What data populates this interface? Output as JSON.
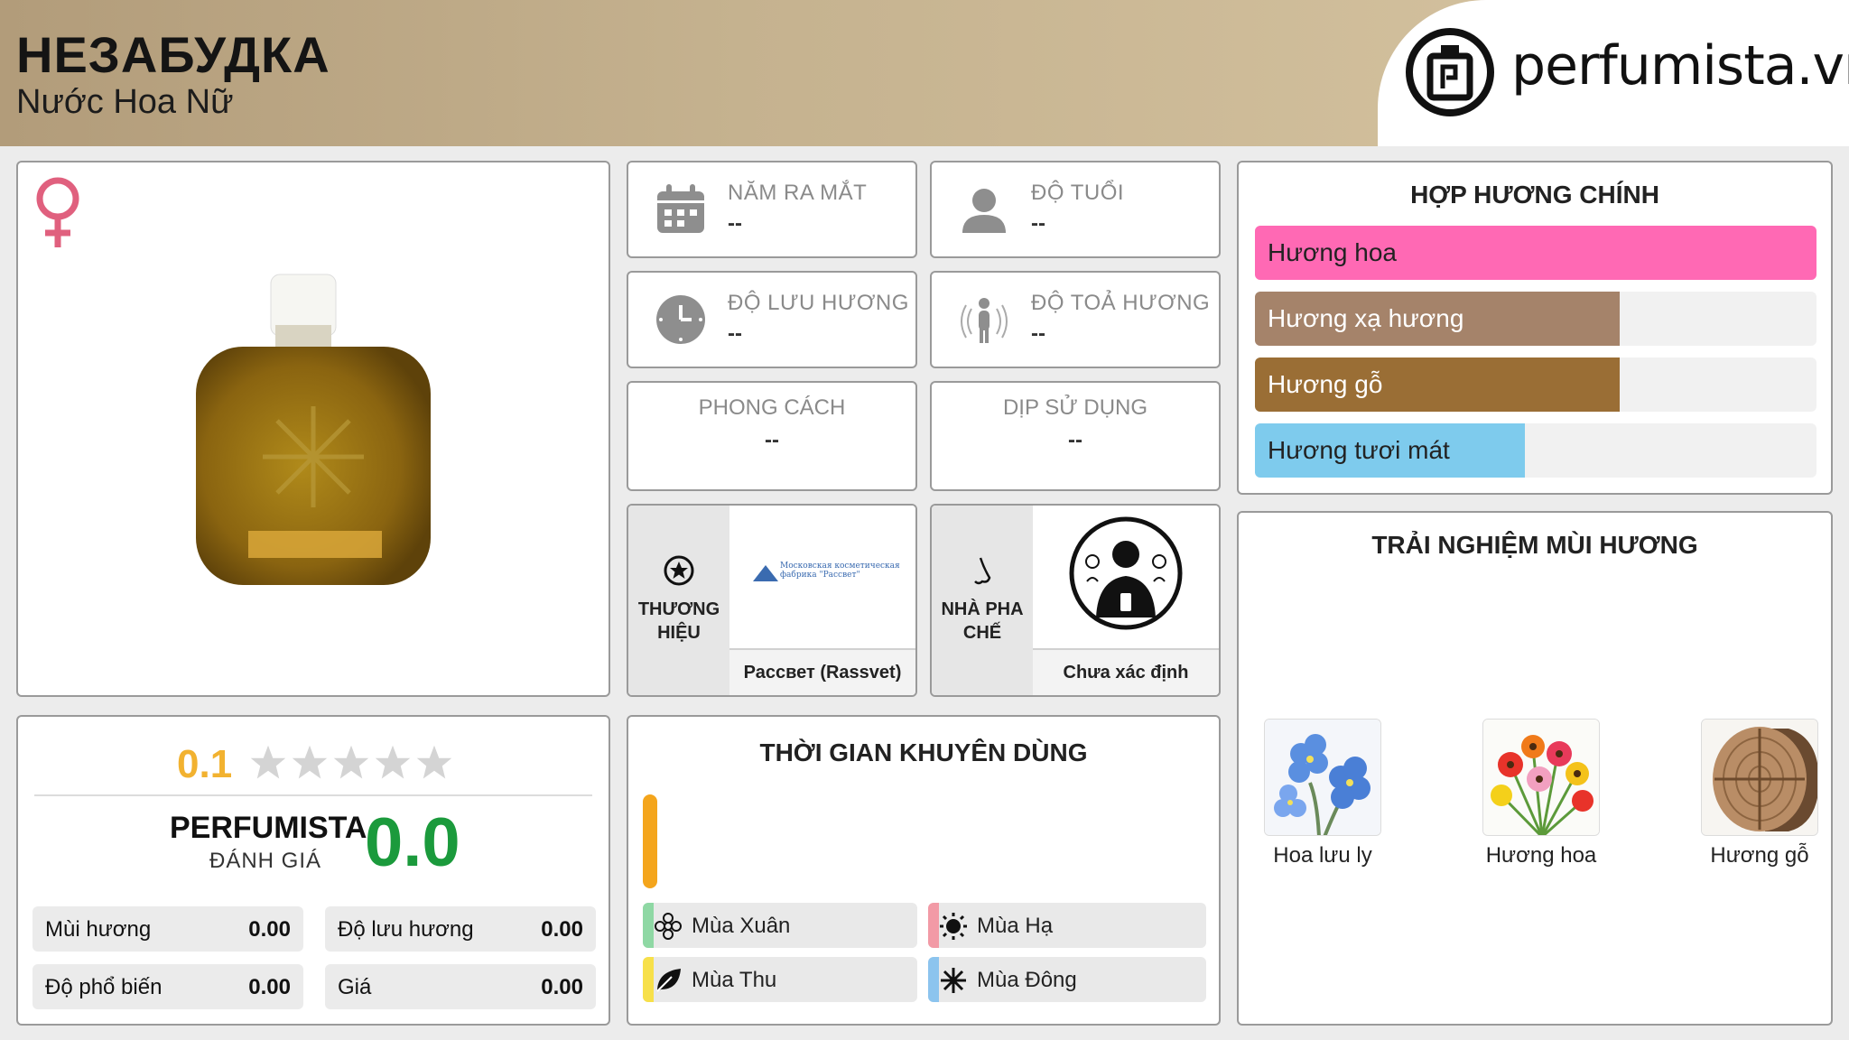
{
  "header": {
    "title": "НЕЗАБУДКА",
    "subtitle": "Nước Hoa Nữ",
    "logo_text": "perfumista.vn"
  },
  "info": {
    "release_label": "NĂM RA MẮT",
    "release_value": "--",
    "age_label": "ĐỘ TUỔI",
    "age_value": "--",
    "longevity_label": "ĐỘ LƯU HƯƠNG",
    "longevity_value": "--",
    "sillage_label": "ĐỘ TOẢ HƯƠNG",
    "sillage_value": "--",
    "style_label": "PHONG CÁCH",
    "style_value": "--",
    "occasion_label": "DỊP SỬ DỤNG",
    "occasion_value": "--"
  },
  "brand": {
    "label_line1": "THƯƠNG",
    "label_line2": "HIỆU",
    "logo_caption": "Московская косметическая фабрика \"Рассвет\"",
    "name": "Рассвет (Rassvet)"
  },
  "perfumer": {
    "label_line1": "NHÀ PHA",
    "label_line2": "CHẾ",
    "name": "Chưa xác định"
  },
  "rating": {
    "score": "0.1",
    "stars_filled": 0,
    "stars_total": 5,
    "pf_label": "PERFUMISTA",
    "pf_sub": "ĐÁNH GIÁ",
    "pf_score": "0.0",
    "metrics": [
      {
        "label": "Mùi hương",
        "value": "0.00"
      },
      {
        "label": "Độ lưu hương",
        "value": "0.00"
      },
      {
        "label": "Độ phổ biến",
        "value": "0.00"
      },
      {
        "label": "Giá",
        "value": "0.00"
      }
    ]
  },
  "seasons": {
    "title": "THỜI GIAN KHUYÊN DÙNG",
    "day_level": 1.0,
    "items": [
      {
        "label": "Mùa Xuân",
        "color": "#8fd8a4"
      },
      {
        "label": "Mùa Hạ",
        "color": "#f29aa6"
      },
      {
        "label": "Mùa Thu",
        "color": "#f7e04a"
      },
      {
        "label": "Mùa Đông",
        "color": "#8cc4ee"
      }
    ]
  },
  "accords": {
    "title": "HỢP HƯƠNG CHÍNH",
    "items": [
      {
        "label": "Hương hoa",
        "level": 1.0,
        "color": "#ff69b4"
      },
      {
        "label": "Hương xạ hương",
        "level": 0.65,
        "color": "#a5836a"
      },
      {
        "label": "Hương gỗ",
        "level": 0.65,
        "color": "#9a6e35"
      },
      {
        "label": "Hương tươi mát",
        "level": 0.48,
        "color": "#7ecbed"
      }
    ]
  },
  "experience": {
    "title": "TRẢI NGHIỆM MÙI HƯƠNG",
    "items": [
      {
        "label": "Hoa lưu ly",
        "icon": "forget-me-not-image"
      },
      {
        "label": "Hương hoa",
        "icon": "flowers-image"
      },
      {
        "label": "Hương gỗ",
        "icon": "wood-image"
      }
    ]
  }
}
